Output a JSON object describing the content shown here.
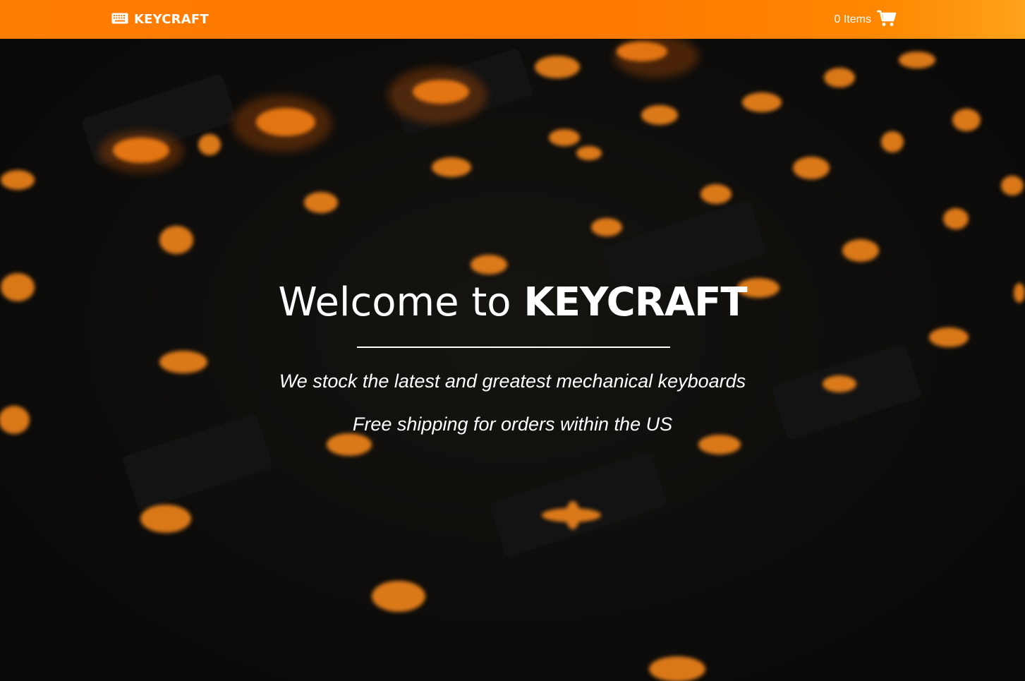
{
  "navbar": {
    "brand_label": "KEYCRAFT",
    "brand_icon": "keyboard-icon",
    "cart_label": "0 Items",
    "cart_icon": "shopping-cart-icon",
    "gradient_colors": [
      "#ff7d00",
      "#ffa31a"
    ]
  },
  "hero": {
    "title_prefix": "Welcome to",
    "title_brand": "KEYCRAFT",
    "tagline": "We stock the latest and greatest mechanical keyboards",
    "shipping_note": "Free shipping for orders within the US",
    "background_theme": "dark backlit keyboard with orange glowing keys",
    "accent_color": "#ff8c1a"
  }
}
